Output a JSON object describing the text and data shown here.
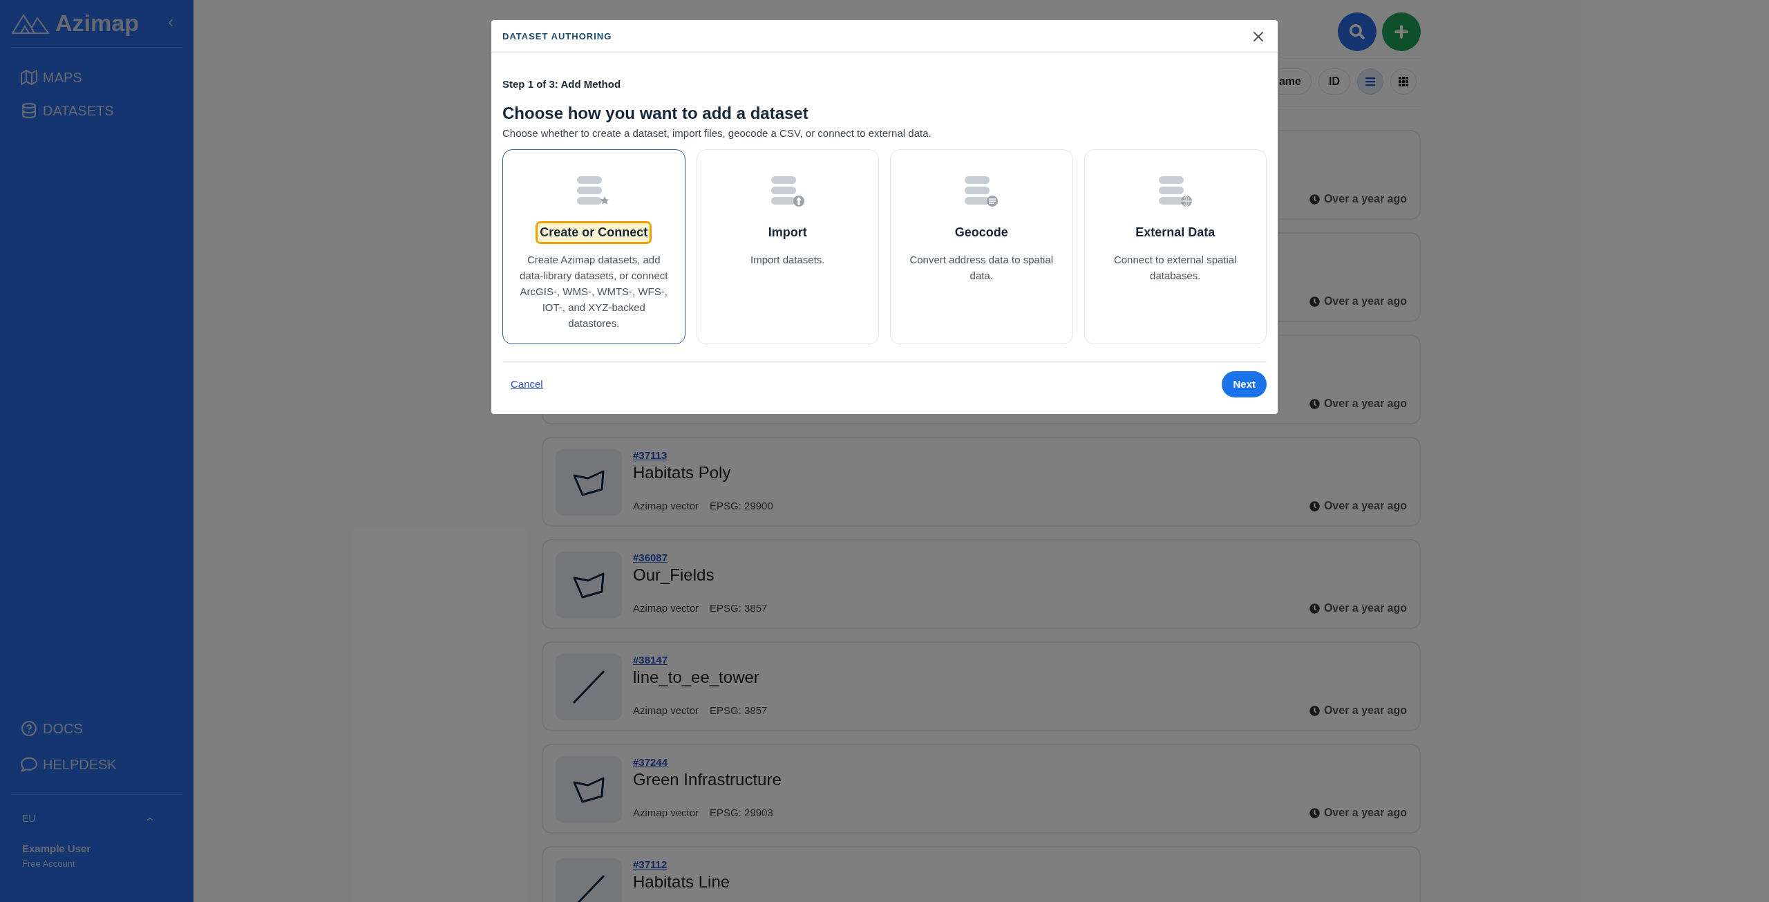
{
  "sidebar": {
    "brand": "Azimap",
    "nav": [
      {
        "label": "MAPS",
        "kind": "map"
      },
      {
        "label": "DATASETS",
        "kind": "database"
      }
    ],
    "help": [
      {
        "label": "DOCS",
        "kind": "docs"
      },
      {
        "label": "HELPDESK",
        "kind": "chat"
      }
    ],
    "region": "EU",
    "user": {
      "name": "Example User",
      "plan": "Free Account"
    }
  },
  "header": {
    "sort_options": [
      {
        "label": "ame"
      },
      {
        "label": "ID"
      }
    ],
    "views": [
      {
        "kind": "list",
        "selected": true
      },
      {
        "kind": "grid",
        "selected": false
      }
    ]
  },
  "datasets": [
    {
      "time": "Over a year ago"
    },
    {
      "time": "Over a year ago"
    },
    {
      "time": "Over a year ago"
    },
    {
      "id": "#37113",
      "name": "Habitats Poly",
      "kind": "polygon",
      "source": "Azimap vector",
      "epsg": "EPSG: 29900",
      "time": "Over a year ago"
    },
    {
      "id": "#36087",
      "name": "Our_Fields",
      "kind": "polygon",
      "source": "Azimap vector",
      "epsg": "EPSG: 3857",
      "time": "Over a year ago"
    },
    {
      "id": "#38147",
      "name": "line_to_ee_tower",
      "kind": "line",
      "source": "Azimap vector",
      "epsg": "EPSG: 3857",
      "time": "Over a year ago"
    },
    {
      "id": "#37244",
      "name": "Green Infrastructure",
      "kind": "polygon",
      "source": "Azimap vector",
      "epsg": "EPSG: 29903",
      "time": "Over a year ago"
    },
    {
      "id": "#37112",
      "name": "Habitats Line",
      "kind": "line"
    }
  ],
  "modal": {
    "title": "DATASET AUTHORING",
    "step": "Step 1 of 3: Add Method",
    "heading": "Choose how you want to add a dataset",
    "subtitle": "Choose whether to create a dataset, import files, geocode a CSV, or connect to external data.",
    "methods": [
      {
        "kind": "create",
        "title": "Create or Connect",
        "description": "Create Azimap datasets, add data-library datasets, or connect ArcGIS-, WMS-, WMTS-, WFS-, IOT-, and XYZ-backed datastores.",
        "selected": true
      },
      {
        "kind": "import",
        "title": "Import",
        "description": "Import datasets.",
        "selected": false
      },
      {
        "kind": "geocode",
        "title": "Geocode",
        "description": "Convert address data to spatial data.",
        "selected": false
      },
      {
        "kind": "external",
        "title": "External Data",
        "description": "Connect to external spatial databases.",
        "selected": false
      }
    ],
    "cancel": "Cancel",
    "next": "Next"
  }
}
